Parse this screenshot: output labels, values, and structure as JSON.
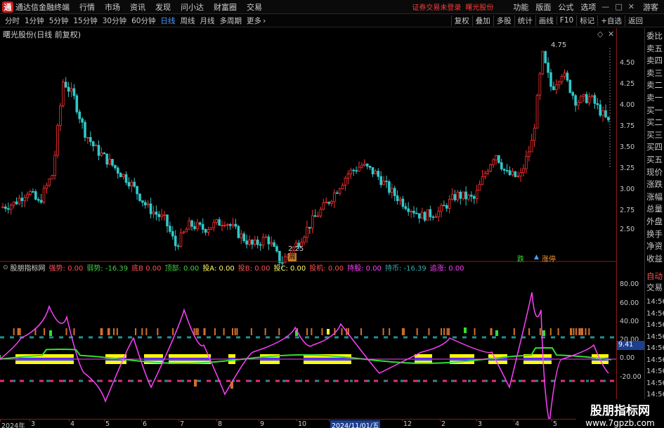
{
  "menubar": {
    "app_title": "通达信金融终端",
    "logo_glyph": "通",
    "items": [
      "行情",
      "市场",
      "资讯",
      "发现",
      "问小达",
      "财富圈",
      "交易"
    ],
    "broker_status": "证券交易未登录",
    "stock_name": "曙光股份",
    "right_items": [
      "功能",
      "版面",
      "公式",
      "选项"
    ],
    "win_controls": [
      "—",
      "□",
      "✕"
    ],
    "guest": "游客"
  },
  "periodbar": {
    "periods": [
      "分时",
      "1分钟",
      "5分钟",
      "15分钟",
      "30分钟",
      "60分钟",
      "日线",
      "周线",
      "月线",
      "多周期",
      "更多"
    ],
    "active": "日线",
    "more_arrow": "›",
    "tools": [
      "复权",
      "叠加",
      "多股",
      "统计",
      "画线",
      "F10",
      "标记",
      "+自选",
      "返回"
    ]
  },
  "main_chart": {
    "title": "曙光股份(日线 前复权)",
    "high_label": "4.75",
    "low_label": "2.25",
    "marker_run": "周",
    "marker_fall": "跌",
    "marker_limit": "涨停",
    "y_ticks": [
      "4.50",
      "4.25",
      "4.00",
      "3.75",
      "3.50",
      "3.25",
      "3.00",
      "2.75",
      "2.50"
    ]
  },
  "indicator": {
    "name": "股朋指标网",
    "fields": [
      {
        "label": "强势:",
        "value": "0.00",
        "color": "#ff5050"
      },
      {
        "label": "弱势:",
        "value": "-16.39",
        "color": "#40d040"
      },
      {
        "label": "底B",
        "value": "0.00",
        "color": "#ff5050"
      },
      {
        "label": "顶部:",
        "value": "0.00",
        "color": "#40d040"
      },
      {
        "label": "投A:",
        "value": "0.00",
        "color": "#ffff60"
      },
      {
        "label": "投B:",
        "value": "0.00",
        "color": "#ff5050"
      },
      {
        "label": "投C:",
        "value": "0.00",
        "color": "#ffff60"
      },
      {
        "label": "投机:",
        "value": "0.00",
        "color": "#ff5050"
      },
      {
        "label": "持股:",
        "value": "0.00",
        "color": "#ff40ff"
      },
      {
        "label": "持币:",
        "value": "-16.39",
        "color": "#30b0b0"
      },
      {
        "label": "追涨:",
        "value": "0.00",
        "color": "#ff40ff"
      }
    ],
    "y_ticks": [
      "80.00",
      "60.00",
      "40.00",
      "20.00",
      "0.00",
      "-20.00"
    ],
    "current_value": "9.41"
  },
  "x_ticks": [
    "2024年",
    "3",
    "4",
    "5",
    "6",
    "7",
    "8",
    "9",
    "10",
    "2024/11/01/五",
    "12",
    "2",
    "3",
    "4",
    "5"
  ],
  "side_panel": {
    "quote_labels": [
      "委比",
      "卖五",
      "卖四",
      "卖三",
      "卖二",
      "卖一",
      "买一",
      "买二",
      "买三",
      "买四",
      "买五",
      "现价",
      "涨跌",
      "涨幅",
      "总量",
      "外盘",
      "换手",
      "净资",
      "收益"
    ],
    "auto_label": "自动",
    "trade_label": "交易",
    "times": [
      "14:56",
      "14:56",
      "14:56",
      "14:56",
      "14:56",
      "14:56",
      "14:56",
      "14:56",
      "14:56",
      "14:56"
    ]
  },
  "colors": {
    "up": "#ff3030",
    "down": "#30c8c8",
    "axis": "#8b1a1a",
    "magenta": "#ff40ff",
    "yellow": "#ffff00",
    "blue": "#2020ff",
    "green": "#30e030"
  },
  "watermark": {
    "cn": "股朋指标网",
    "url": "www.7gpzb.com"
  }
}
